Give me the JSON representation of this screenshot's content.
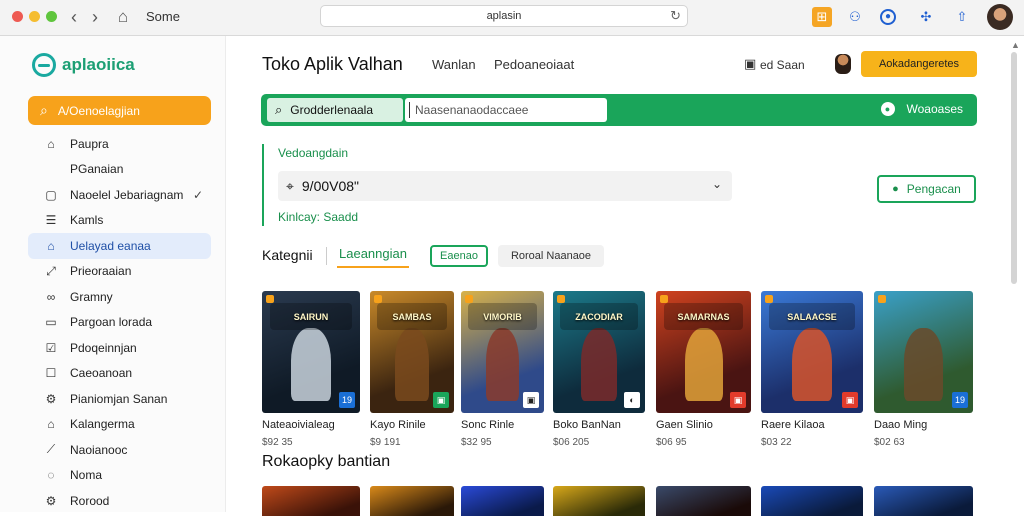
{
  "browser": {
    "tab_title": "Some",
    "url": "aplasin",
    "icons": [
      "back-icon",
      "forward-icon",
      "home-icon",
      "reload-icon"
    ]
  },
  "sidebar": {
    "logo_text": "aplaoiica",
    "search_label": "A/Oenoelagjian",
    "items": [
      {
        "icon": "⌂",
        "label": "Paupra"
      },
      {
        "icon": "",
        "label": "PGanaian"
      },
      {
        "icon": "▢",
        "label": "Naoelel Jebariagnam",
        "check": "✓"
      },
      {
        "icon": "☰",
        "label": "Kamls"
      },
      {
        "icon": "⌂",
        "label": "Uelayad eanaa",
        "active": true
      },
      {
        "icon": "⤢",
        "label": "Prieoraaian"
      },
      {
        "icon": "∞",
        "label": "Gramny"
      },
      {
        "icon": "▭",
        "label": "Pargoan lorada"
      },
      {
        "icon": "☑",
        "label": "Pdoqeinnjan"
      },
      {
        "icon": "☐",
        "label": "Caeoanoan"
      },
      {
        "icon": "⚙",
        "label": "Pianiomjan Sanan"
      },
      {
        "icon": "⌂",
        "label": "Kalangerma"
      },
      {
        "icon": "⟋",
        "label": "Naoianooc"
      },
      {
        "icon": "◌",
        "label": "Noma"
      },
      {
        "icon": "⚙",
        "label": "Rorood"
      }
    ]
  },
  "header": {
    "title": "Toko Aplik Valhan",
    "link1": "Wanlan",
    "link2": "Pedoaneoiaat",
    "right_text": "ed Saan",
    "button": "Aokadangeretes"
  },
  "searchbar": {
    "category": "Grodderlenaala",
    "placeholder": "Naasenanaodaccaee",
    "right_label": "Woaoases"
  },
  "filter": {
    "label": "Vedoangdain",
    "selected": "9/00V08\"",
    "hint": "Kinlcay: Saadd",
    "apply_button": "Pengacan"
  },
  "categories": {
    "label": "Kategnii",
    "chips": [
      "Laeanngian",
      "Eaenao",
      "Roroal  Naanaoe"
    ]
  },
  "games": [
    {
      "title": "Nateaoivialeag",
      "price": "$92 35",
      "banner": "SAIRUN",
      "badge": "19",
      "colors": [
        "#2a3a4f",
        "#0f1a26",
        "#c9d3dd"
      ],
      "badge_color": "#1a6fd6"
    },
    {
      "title": "Kayo Rinile",
      "price": "$9 191",
      "banner": "SAMBAS",
      "badge": "▣",
      "colors": [
        "#c98a2a",
        "#3b2410",
        "#7a4a1d"
      ],
      "badge_color": "#1aa55a"
    },
    {
      "title": "Sonc Rinle",
      "price": "$32 95",
      "banner": "VIMORIB",
      "badge": "▣",
      "colors": [
        "#d8b24a",
        "#2f4a8a",
        "#8a3b2b"
      ],
      "badge_color": "#ffffff"
    },
    {
      "title": "Boko BanNan",
      "price": "$06 205",
      "banner": "ZACODIAR",
      "badge": "◐",
      "colors": [
        "#1c7a8a",
        "#0e2b3c",
        "#7a2a2a"
      ],
      "badge_color": "#ffffff"
    },
    {
      "title": "Gaen Slinio",
      "price": "$06 95",
      "banner": "SAMARNAS",
      "badge": "▣",
      "colors": [
        "#d0431f",
        "#4a1412",
        "#e1a23a"
      ],
      "badge_color": "#e23b2b"
    },
    {
      "title": "Raere Kilaoa",
      "price": "$03 22",
      "banner": "SALAACSE",
      "badge": "▣",
      "colors": [
        "#3a7ad8",
        "#1c2f6a",
        "#d7532a"
      ],
      "badge_color": "#e23b2b"
    },
    {
      "title": "Daao Ming",
      "price": "$02 63",
      "banner": "",
      "badge": "19",
      "colors": [
        "#3aa0c8",
        "#2f5a2f",
        "#6a4a2a"
      ],
      "badge_color": "#1a6fd6"
    }
  ],
  "section2": {
    "title": "Rokaopky bantian",
    "cards": [
      {
        "colors": [
          "#c04a1a",
          "#3a1208"
        ]
      },
      {
        "colors": [
          "#d98a1a",
          "#2a1808"
        ]
      },
      {
        "colors": [
          "#2a4ad8",
          "#0a1a4a"
        ]
      },
      {
        "colors": [
          "#d8a81a",
          "#2a2a08"
        ]
      },
      {
        "colors": [
          "#3a4a6a",
          "#1a0a08"
        ]
      },
      {
        "colors": [
          "#1a4ab8",
          "#0a1a3a"
        ]
      },
      {
        "colors": [
          "#2a5ab8",
          "#0a1a3a"
        ]
      }
    ]
  }
}
